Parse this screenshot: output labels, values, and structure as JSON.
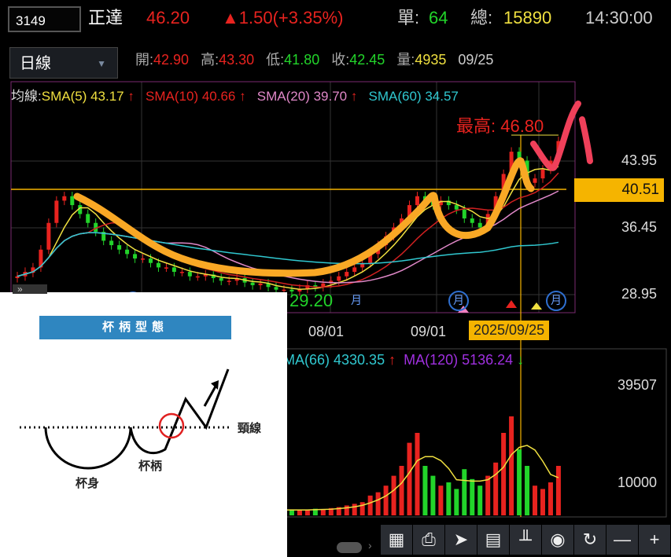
{
  "header": {
    "code": "3149",
    "name": "正達",
    "price": "46.20",
    "change": "▲1.50(+3.35%)",
    "single_label": "單:",
    "single": "64",
    "total_label": "總:",
    "total": "15890",
    "time": "14:30:00"
  },
  "period": {
    "selected": "日線",
    "arrow": "▼"
  },
  "ohlc": {
    "open_label": "開:",
    "open": "42.90",
    "high_label": "高:",
    "high": "43.30",
    "low_label": "低:",
    "low": "41.80",
    "close_label": "收:",
    "close": "42.45",
    "vol_label": "量:",
    "vol": "4935",
    "date": "09/25"
  },
  "legend": {
    "prefix": "均線:",
    "sma5": "SMA(5) 43.17",
    "sma10": "SMA(10) 40.66",
    "sma20": "SMA(20) 39.70",
    "sma60": "SMA(60) 34.57",
    "up": "↑"
  },
  "annotations": {
    "max": "最高: 46.80",
    "min": "29.20",
    "month": "月"
  },
  "vol_legend": {
    "ma66": "MA(66) 4330.35",
    "ma120": "MA(120) 5136.24",
    "up": "↑",
    "down": "↓"
  },
  "toolbar": [
    "grid-search",
    "print",
    "pointer",
    "layout",
    "candle-settings",
    "eye",
    "refresh",
    "minus",
    "plus"
  ],
  "toolbar_glyphs": [
    "▦",
    "⎙",
    "➤",
    "▤",
    "╨",
    "◉",
    "↻",
    "—",
    "+"
  ],
  "inset": {
    "title": "杯柄型態",
    "neckline": "頸線",
    "cup": "杯身",
    "handle": "杯柄"
  },
  "colors": {
    "up": "#e8231f",
    "down": "#22d42a",
    "sma5": "#f0e040",
    "sma10": "#d02020",
    "sma20": "#e088c8",
    "sma60": "#30c8d0",
    "accent": "#f5b400"
  },
  "chart_data": {
    "type": "candlestick",
    "price_axis": {
      "ticks": [
        "43.95",
        "40.51",
        "36.45",
        "28.95"
      ],
      "range": [
        26.5,
        49
      ]
    },
    "date_labels": [
      "08/01",
      "09/01",
      "2025/09/25"
    ],
    "volume_axis": {
      "ticks": [
        "39507",
        "10000"
      ]
    },
    "candles_open_close": [
      [
        30.8,
        31
      ],
      [
        31,
        31.5
      ],
      [
        31.4,
        32
      ],
      [
        32,
        34
      ],
      [
        34,
        37
      ],
      [
        37,
        39.5
      ],
      [
        39.5,
        40
      ],
      [
        40,
        39
      ],
      [
        39,
        38
      ],
      [
        38,
        37
      ],
      [
        37,
        36
      ],
      [
        36,
        35
      ],
      [
        35,
        34.5
      ],
      [
        34.5,
        34
      ],
      [
        34,
        33.5
      ],
      [
        33.5,
        33
      ],
      [
        33,
        33
      ],
      [
        33,
        32.5
      ],
      [
        32.5,
        32
      ],
      [
        32,
        32
      ],
      [
        32,
        31.5
      ],
      [
        31.5,
        31.5
      ],
      [
        31.5,
        31
      ],
      [
        31,
        31
      ],
      [
        31,
        31.2
      ],
      [
        31.2,
        30.8
      ],
      [
        30.8,
        30.5
      ],
      [
        30.5,
        30.5
      ],
      [
        30.5,
        30.8
      ],
      [
        30.8,
        30.3
      ],
      [
        30.3,
        30
      ],
      [
        30,
        30.2
      ],
      [
        30.2,
        29.8
      ],
      [
        29.8,
        29.5
      ],
      [
        29.5,
        29.5
      ],
      [
        29.5,
        29.3
      ],
      [
        29.3,
        29.6
      ],
      [
        29.6,
        30
      ],
      [
        30,
        29.8
      ],
      [
        29.8,
        30.2
      ],
      [
        30.2,
        30.5
      ],
      [
        30.5,
        31
      ],
      [
        31,
        31.5
      ],
      [
        31.5,
        32
      ],
      [
        32,
        32.5
      ],
      [
        32.5,
        33.5
      ],
      [
        33.5,
        34.5
      ],
      [
        34.5,
        35.5
      ],
      [
        35.5,
        36.5
      ],
      [
        36.5,
        37.5
      ],
      [
        37.5,
        39
      ],
      [
        39,
        40
      ],
      [
        40,
        39.5
      ],
      [
        39.5,
        39
      ],
      [
        39,
        39.5
      ],
      [
        39.5,
        39
      ],
      [
        39,
        38.5
      ],
      [
        38.5,
        37.5
      ],
      [
        37.5,
        37
      ],
      [
        37,
        36.5
      ],
      [
        36.5,
        38
      ],
      [
        38,
        40
      ],
      [
        40,
        42.5
      ],
      [
        42.5,
        45
      ],
      [
        45,
        44
      ],
      [
        44,
        41.5
      ],
      [
        41.5,
        42
      ],
      [
        42,
        43
      ],
      [
        43,
        44
      ],
      [
        44,
        46.2
      ]
    ],
    "volumes": [
      3000,
      2800,
      3500,
      6000,
      9000,
      12000,
      9000,
      6000,
      5000,
      4000,
      3500,
      3000,
      3000,
      2800,
      2500,
      2500,
      2400,
      2600,
      2300,
      2200,
      2200,
      2000,
      2100,
      2000,
      1900,
      2000,
      1800,
      1900,
      1800,
      1700,
      1800,
      1600,
      1700,
      1600,
      1500,
      1800,
      1600,
      1700,
      2000,
      1800,
      2200,
      2500,
      3000,
      3500,
      4000,
      6000,
      7000,
      9000,
      12000,
      15000,
      22000,
      25000,
      15000,
      12000,
      9000,
      10000,
      8000,
      14000,
      11000,
      9000,
      12000,
      16000,
      25000,
      30000,
      20000,
      15000,
      9000,
      8000,
      10000,
      15000
    ]
  }
}
